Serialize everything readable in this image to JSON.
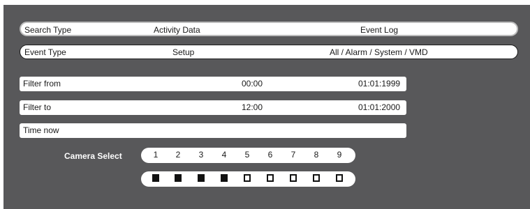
{
  "search": {
    "label": "Search Type",
    "option1": "Activity Data",
    "option2": "Event Log"
  },
  "event": {
    "label": "Event Type",
    "option1": "Setup",
    "option2": "All / Alarm / System / VMD"
  },
  "filter_from": {
    "label": "Filter from",
    "time": "00:00",
    "date": "01:01:1999"
  },
  "filter_to": {
    "label": "Filter to",
    "time": "12:00",
    "date": "01:01:2000"
  },
  "time_now": {
    "label": "Time now"
  },
  "camera_select": {
    "label": "Camera Select",
    "numbers": [
      "1",
      "2",
      "3",
      "4",
      "5",
      "6",
      "7",
      "8",
      "9"
    ],
    "selected": [
      true,
      true,
      true,
      true,
      false,
      false,
      false,
      false,
      false
    ]
  }
}
